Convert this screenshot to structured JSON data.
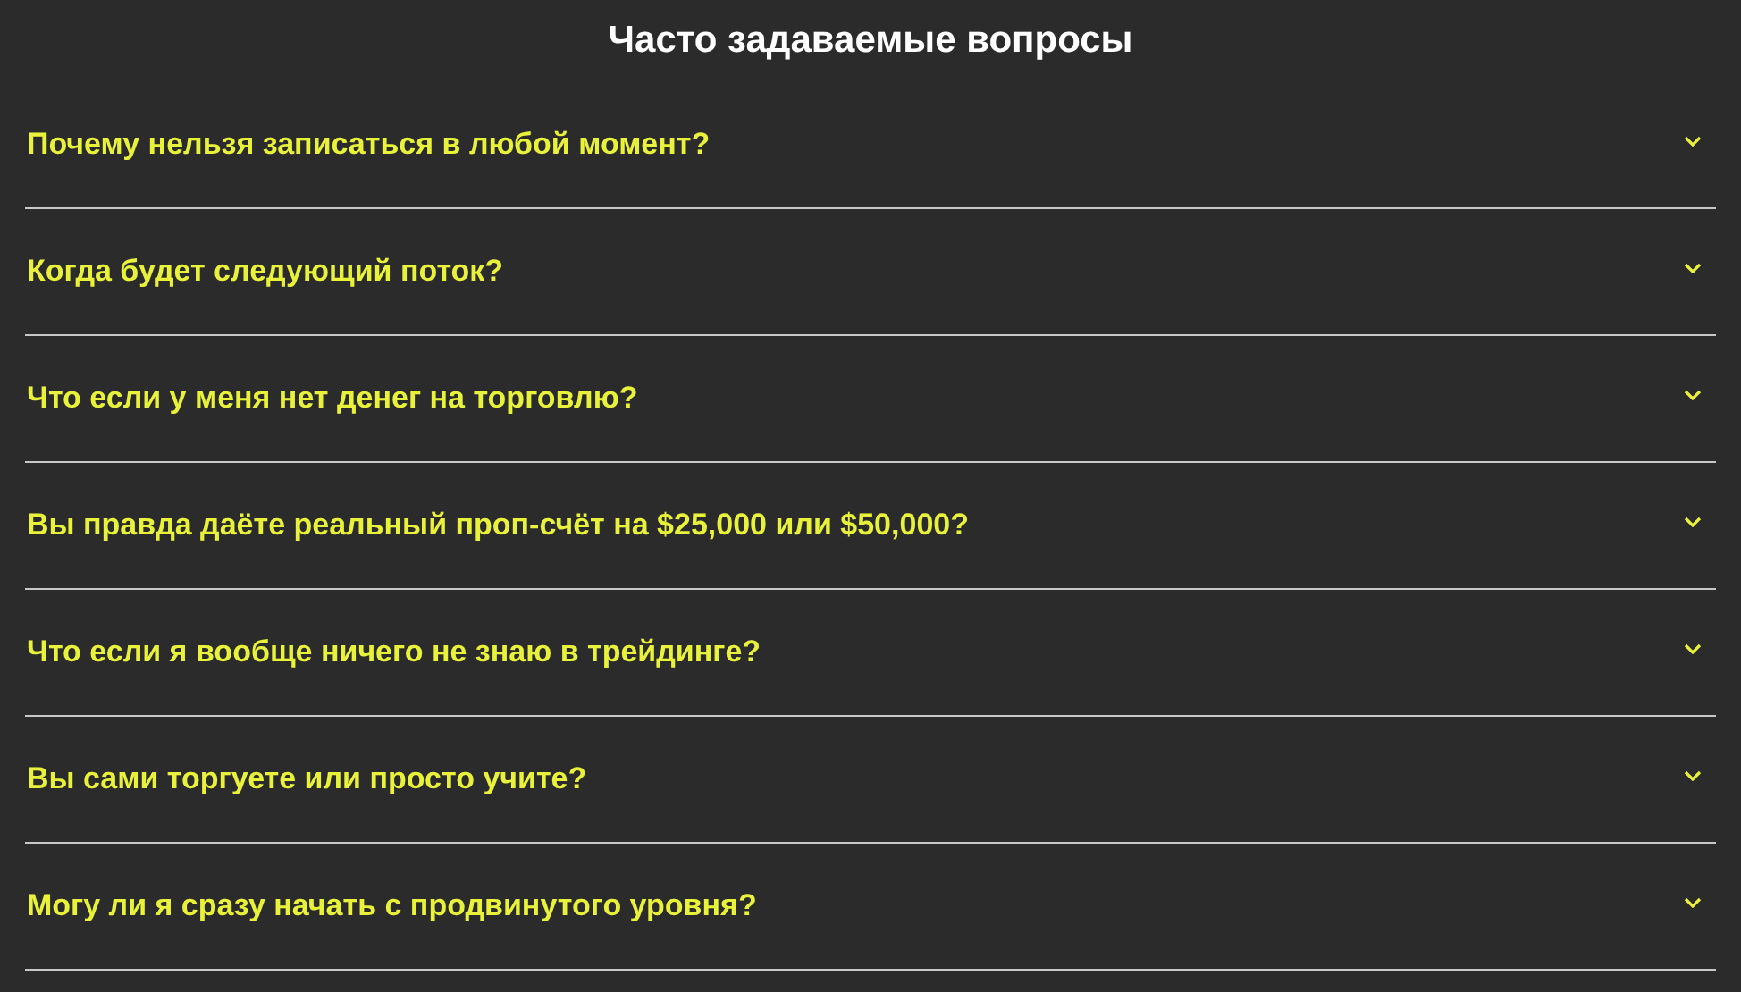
{
  "title": "Часто задаваемые вопросы",
  "faq": [
    {
      "question": "Почему нельзя записаться в любой момент?",
      "expanded": false
    },
    {
      "question": "Когда будет следующий поток?",
      "expanded": false
    },
    {
      "question": "Что если у меня нет денег на торговлю?",
      "expanded": false
    },
    {
      "question": "Вы правда даёте реальный проп-счёт на $25,000 или $50,000?",
      "expanded": false
    },
    {
      "question": "Что если я вообще ничего не знаю в трейдинге?",
      "expanded": false
    },
    {
      "question": "Вы сами торгуете или просто учите?",
      "expanded": false
    },
    {
      "question": "Могу ли я сразу начать с продвинутого уровня?",
      "expanded": false
    }
  ]
}
